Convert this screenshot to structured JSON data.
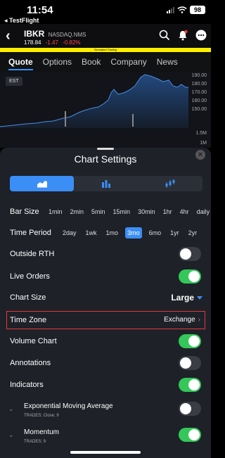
{
  "status_bar": {
    "time": "11:54",
    "back_app": "◂ TestFlight",
    "battery": "98"
  },
  "header": {
    "symbol": "IBKR",
    "exchange": "NASDAQ.NMS",
    "price": "178.84",
    "change": "-1.47",
    "change_pct": "-0.82%",
    "simulated_label": "Simulated Trading"
  },
  "tabs": [
    {
      "label": "Quote",
      "active": true
    },
    {
      "label": "Options",
      "active": false
    },
    {
      "label": "Book",
      "active": false
    },
    {
      "label": "Company",
      "active": false
    },
    {
      "label": "News",
      "active": false
    }
  ],
  "chart": {
    "timezone_badge": "EST",
    "price_labels": [
      "190.00",
      "180.00",
      "170.00",
      "160.00",
      "150.00"
    ],
    "volume_labels": [
      "1.5M",
      "1M"
    ]
  },
  "sheet": {
    "title": "Chart Settings",
    "chart_types": [
      {
        "icon": "area-chart-icon",
        "active": true
      },
      {
        "icon": "bar-chart-icon",
        "active": false
      },
      {
        "icon": "candlestick-chart-icon",
        "active": false
      }
    ],
    "bar_size": {
      "label": "Bar Size",
      "options": [
        "1min",
        "2min",
        "5min",
        "15min",
        "30min",
        "1hr",
        "4hr",
        "daily"
      ],
      "selected": -1
    },
    "time_period": {
      "label": "Time Period",
      "options": [
        "2day",
        "1wk",
        "1mo",
        "3mo",
        "6mo",
        "1yr",
        "2yr"
      ],
      "selected": 3
    },
    "outside_rth": {
      "label": "Outside RTH",
      "on": false
    },
    "live_orders": {
      "label": "Live Orders",
      "on": true
    },
    "chart_size": {
      "label": "Chart Size",
      "value": "Large"
    },
    "time_zone": {
      "label": "Time Zone",
      "value": "Exchange"
    },
    "volume_chart": {
      "label": "Volume Chart",
      "on": true
    },
    "annotations": {
      "label": "Annotations",
      "on": false
    },
    "indicators": {
      "label": "Indicators",
      "on": true
    },
    "indicator_items": [
      {
        "name": "Exponential Moving Average",
        "params": "TRADES; Close; 9",
        "on": false
      },
      {
        "name": "Momentum",
        "params": "TRADES; 9",
        "on": true
      }
    ]
  },
  "colors": {
    "accent": "#3b8ef5",
    "toggle_on": "#34c759",
    "negative": "#ff4a4a",
    "highlight_border": "#e23b3b"
  }
}
